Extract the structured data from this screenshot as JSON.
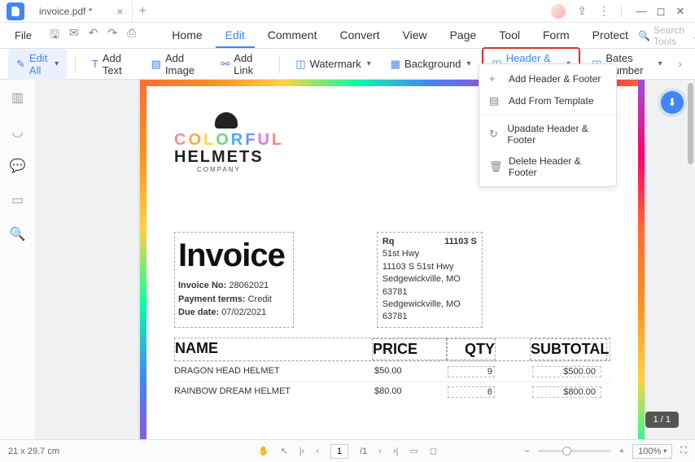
{
  "titleBar": {
    "tabName": "invoice.pdf *"
  },
  "menuBar": {
    "file": "File",
    "tabs": [
      "Home",
      "Edit",
      "Comment",
      "Convert",
      "View",
      "Page",
      "Tool",
      "Form",
      "Protect"
    ],
    "activeTab": "Edit",
    "searchPlaceholder": "Search Tools"
  },
  "toolbar": {
    "editAll": "Edit All",
    "addText": "Add Text",
    "addImage": "Add Image",
    "addLink": "Add Link",
    "watermark": "Watermark",
    "background": "Background",
    "headerFooter": "Header & Footer",
    "batesNumber": "Bates Number"
  },
  "dropdown": {
    "add": "Add Header & Footer",
    "template": "Add From Template",
    "update": "Upadate Header & Footer",
    "delete": "Delete Header & Footer"
  },
  "doc": {
    "logo": {
      "line1": "COLORFUL",
      "line2": "HELMETS",
      "line3": "COMPANY"
    },
    "invoiceTitle": "Invoice",
    "meta": {
      "noLabel": "Invoice No:",
      "no": "28062021",
      "termsLabel": "Payment terms:",
      "terms": "Credit",
      "dueLabel": "Due date:",
      "due": "07/02/2021"
    },
    "addr": {
      "rq": "Rq",
      "zip": "11103 S",
      "l1": "51st Hwy",
      "l2": "11103 S 51st Hwy",
      "l3": "Sedgewickville, MO",
      "l4": "63781",
      "l5": "Sedgewickville, MO",
      "l6": "63781"
    },
    "headers": {
      "name": "NAME",
      "price": "PRICE",
      "qty": "QTY",
      "subtotal": "SUBTOTAL"
    },
    "rows": [
      {
        "name": "DRAGON HEAD HELMET",
        "price": "$50.00",
        "qty": "9",
        "subtotal": "$500.00"
      },
      {
        "name": "RAINBOW DREAM HELMET",
        "price": "$80.00",
        "qty": "6",
        "subtotal": "$800.00"
      }
    ]
  },
  "pageIndicator": "1 / 1",
  "status": {
    "dims": "21 x 29.7 cm",
    "pageCurrent": "1",
    "pageTotal": "/1",
    "zoom": "100%"
  }
}
